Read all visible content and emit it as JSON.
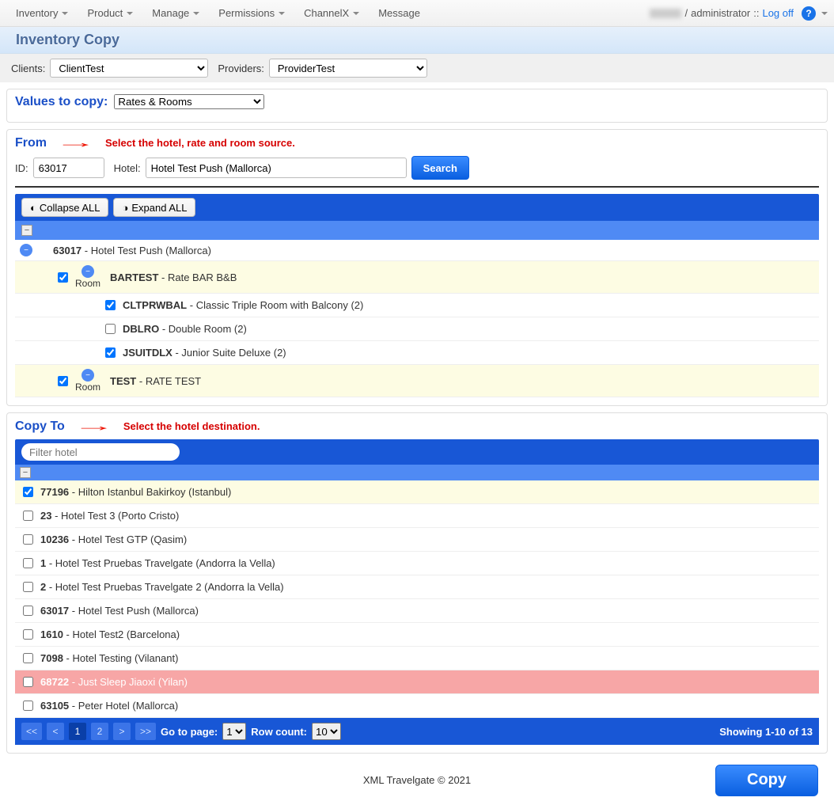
{
  "nav": {
    "items": [
      "Inventory",
      "Product",
      "Manage",
      "Permissions",
      "ChannelX",
      "Message"
    ],
    "role": "administrator",
    "sep": " / ",
    "dblcolon": " :: ",
    "logoff": "Log off"
  },
  "page_title": "Inventory Copy",
  "clients_label": "Clients:",
  "clients_value": "ClientTest",
  "providers_label": "Providers:",
  "providers_value": "ProviderTest",
  "values_label": "Values to copy:",
  "values_selected": "Rates & Rooms",
  "from": {
    "title": "From",
    "helper": "Select the hotel, rate and room source.",
    "id_label": "ID:",
    "id_value": "63017",
    "hotel_label": "Hotel:",
    "hotel_value": "Hotel Test Push (Mallorca)",
    "search": "Search",
    "collapse": "Collapse ALL",
    "expand": "Expand ALL",
    "hotel_line": {
      "code": "63017",
      "sep": " - ",
      "name": "Hotel Test Push (Mallorca)"
    },
    "room_word": "Room",
    "rates": [
      {
        "code": "BARTEST",
        "sep": " - ",
        "name": "Rate BAR B&B",
        "checked": true,
        "rooms": [
          {
            "code": "CLTPRWBAL",
            "sep": " - ",
            "name": "Classic Triple Room with Balcony (2)",
            "checked": true
          },
          {
            "code": "DBLRO",
            "sep": " - ",
            "name": "Double Room (2)",
            "checked": false
          },
          {
            "code": "JSUITDLX",
            "sep": " - ",
            "name": "Junior Suite Deluxe (2)",
            "checked": true
          }
        ]
      },
      {
        "code": "TEST",
        "sep": " - ",
        "name": "RATE TEST",
        "checked": true,
        "rooms": []
      }
    ]
  },
  "copyto": {
    "title": "Copy To",
    "helper": "Select the hotel destination.",
    "filter_placeholder": "Filter hotel",
    "hotels": [
      {
        "code": "77196",
        "sep": " - ",
        "name": "Hilton Istanbul Bakirkoy (Istanbul)",
        "checked": true,
        "hl": "cream"
      },
      {
        "code": "23",
        "sep": " - ",
        "name": "Hotel Test 3 (Porto Cristo)",
        "checked": false,
        "hl": "white"
      },
      {
        "code": "10236",
        "sep": " - ",
        "name": "Hotel Test GTP (Qasim)",
        "checked": false,
        "hl": "white"
      },
      {
        "code": "1",
        "sep": " - ",
        "name": "Hotel Test Pruebas Travelgate (Andorra la Vella)",
        "checked": false,
        "hl": "white"
      },
      {
        "code": "2",
        "sep": " - ",
        "name": "Hotel Test Pruebas Travelgate 2 (Andorra la Vella)",
        "checked": false,
        "hl": "white"
      },
      {
        "code": "63017",
        "sep": " - ",
        "name": "Hotel Test Push (Mallorca)",
        "checked": false,
        "hl": "white"
      },
      {
        "code": "1610",
        "sep": " - ",
        "name": "Hotel Test2 (Barcelona)",
        "checked": false,
        "hl": "white"
      },
      {
        "code": "7098",
        "sep": " - ",
        "name": "Hotel Testing (Vilanant)",
        "checked": false,
        "hl": "white"
      },
      {
        "code": "68722",
        "sep": " - ",
        "name": "Just Sleep Jiaoxi (Yilan)",
        "checked": false,
        "hl": "pink"
      },
      {
        "code": "63105",
        "sep": " - ",
        "name": "Peter Hotel (Mallorca)",
        "checked": false,
        "hl": "white"
      }
    ]
  },
  "pager": {
    "first": "<<",
    "prev": "<",
    "p1": "1",
    "p2": "2",
    "next": ">",
    "last": ">>",
    "goto_label": "Go to page:",
    "goto_value": "1",
    "rowcount_label": "Row count:",
    "rowcount_value": "10",
    "showing": "Showing 1-10 of 13"
  },
  "footer": {
    "copyright": "XML Travelgate © 2021",
    "copy_btn": "Copy"
  }
}
